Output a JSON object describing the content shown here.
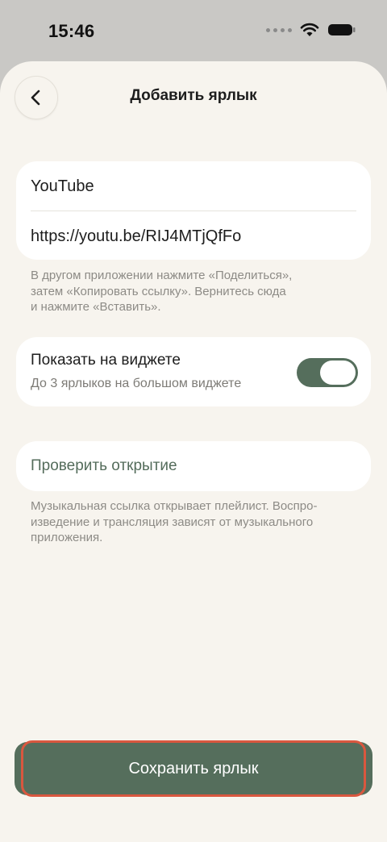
{
  "status": {
    "time": "15:46"
  },
  "header": {
    "title": "Добавить ярлык"
  },
  "shortcut": {
    "name": "YouTube",
    "url": "https://youtu.be/RIJ4MTjQfFo"
  },
  "paste_hint": {
    "line1": "В другом приложении нажмите «Поделиться»,",
    "line2": "затем «Копировать ссылку». Вернитесь сюда",
    "line3": "и нажмите «Вставить»."
  },
  "widget": {
    "title": "Показать на виджете",
    "subtitle": "До 3 ярлыков на большом виджете",
    "enabled": true
  },
  "check": {
    "label": "Проверить открытие"
  },
  "music_hint": {
    "line1": "Музыкальная ссылка открывает плейлист. Воспро-",
    "line2": "изведение и трансляция зависят от музыкального",
    "line3": "приложения."
  },
  "actions": {
    "save_label": "Сохранить ярлык"
  },
  "colors": {
    "accent": "#556e5c",
    "background": "#f7f4ee",
    "highlight": "#d9573f"
  },
  "icons": [
    "back-chevron-icon",
    "wifi-icon",
    "battery-icon",
    "signal-dots-icon"
  ]
}
